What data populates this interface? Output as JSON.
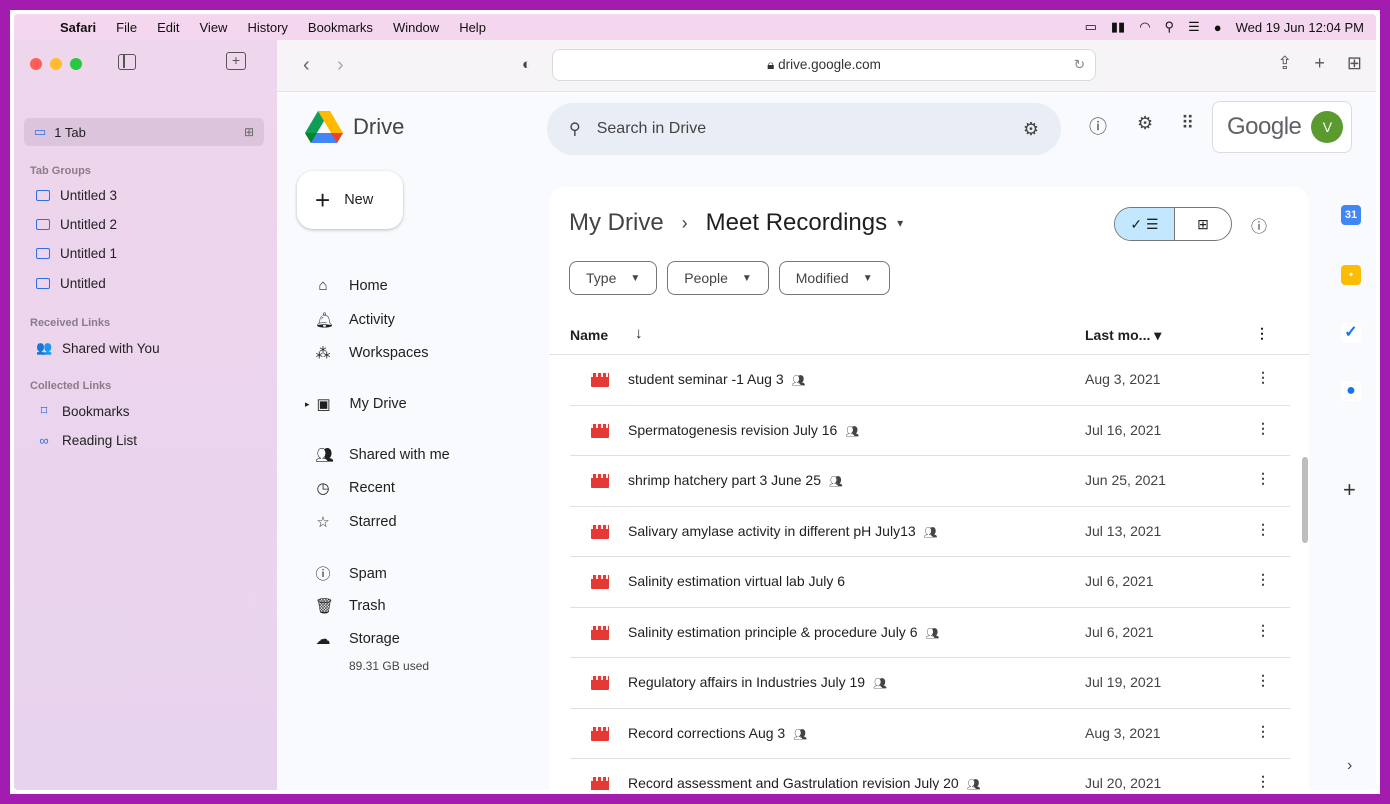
{
  "menubar": {
    "apple": "",
    "items": [
      "Safari",
      "File",
      "Edit",
      "View",
      "History",
      "Bookmarks",
      "Window",
      "Help"
    ],
    "datetime": "Wed 19 Jun  12:04 PM"
  },
  "safari_sidebar": {
    "tab_count": "1 Tab",
    "tab_groups_title": "Tab Groups",
    "tab_groups": [
      "Untitled 3",
      "Untitled 2",
      "Untitled 1",
      "Untitled"
    ],
    "received_links_title": "Received Links",
    "shared_with_you": "Shared with You",
    "collected_links_title": "Collected Links",
    "bookmarks": "Bookmarks",
    "reading_list": "Reading List"
  },
  "toolbar": {
    "url": "drive.google.com"
  },
  "drive": {
    "app_name": "Drive",
    "search_placeholder": "Search in Drive",
    "google_label": "Google",
    "avatar_initial": "V",
    "new_label": "New",
    "nav": {
      "home": "Home",
      "activity": "Activity",
      "workspaces": "Workspaces",
      "my_drive": "My Drive",
      "shared_with_me": "Shared with me",
      "recent": "Recent",
      "starred": "Starred",
      "spam": "Spam",
      "trash": "Trash",
      "storage": "Storage"
    },
    "storage_used": "89.31 GB used",
    "breadcrumb_root": "My Drive",
    "breadcrumb_current": "Meet Recordings",
    "filters": [
      "Type",
      "People",
      "Modified"
    ],
    "columns": {
      "name": "Name",
      "last_modified": "Last mo..."
    },
    "files": [
      {
        "name": "student seminar -1 Aug 3",
        "shared": true,
        "date": "Aug 3, 2021"
      },
      {
        "name": "Spermatogenesis revision July 16",
        "shared": true,
        "date": "Jul 16, 2021"
      },
      {
        "name": "shrimp hatchery part 3 June 25",
        "shared": true,
        "date": "Jun 25, 2021"
      },
      {
        "name": "Salivary amylase activity in different pH July13",
        "shared": true,
        "date": "Jul 13, 2021"
      },
      {
        "name": "Salinity estimation virtual lab July 6",
        "shared": false,
        "date": "Jul 6, 2021"
      },
      {
        "name": "Salinity estimation principle & procedure July 6",
        "shared": true,
        "date": "Jul 6, 2021"
      },
      {
        "name": "Regulatory affairs in Industries July 19",
        "shared": true,
        "date": "Jul 19, 2021"
      },
      {
        "name": "Record corrections Aug 3",
        "shared": true,
        "date": "Aug 3, 2021"
      },
      {
        "name": "Record assessment and Gastrulation revision  July 20",
        "shared": true,
        "date": "Jul 20, 2021"
      }
    ]
  },
  "colors": {
    "frame": "#a21caf",
    "accent_blue": "#c2e7ff",
    "video_red": "#e53935",
    "avatar_green": "#5a9a2e"
  }
}
